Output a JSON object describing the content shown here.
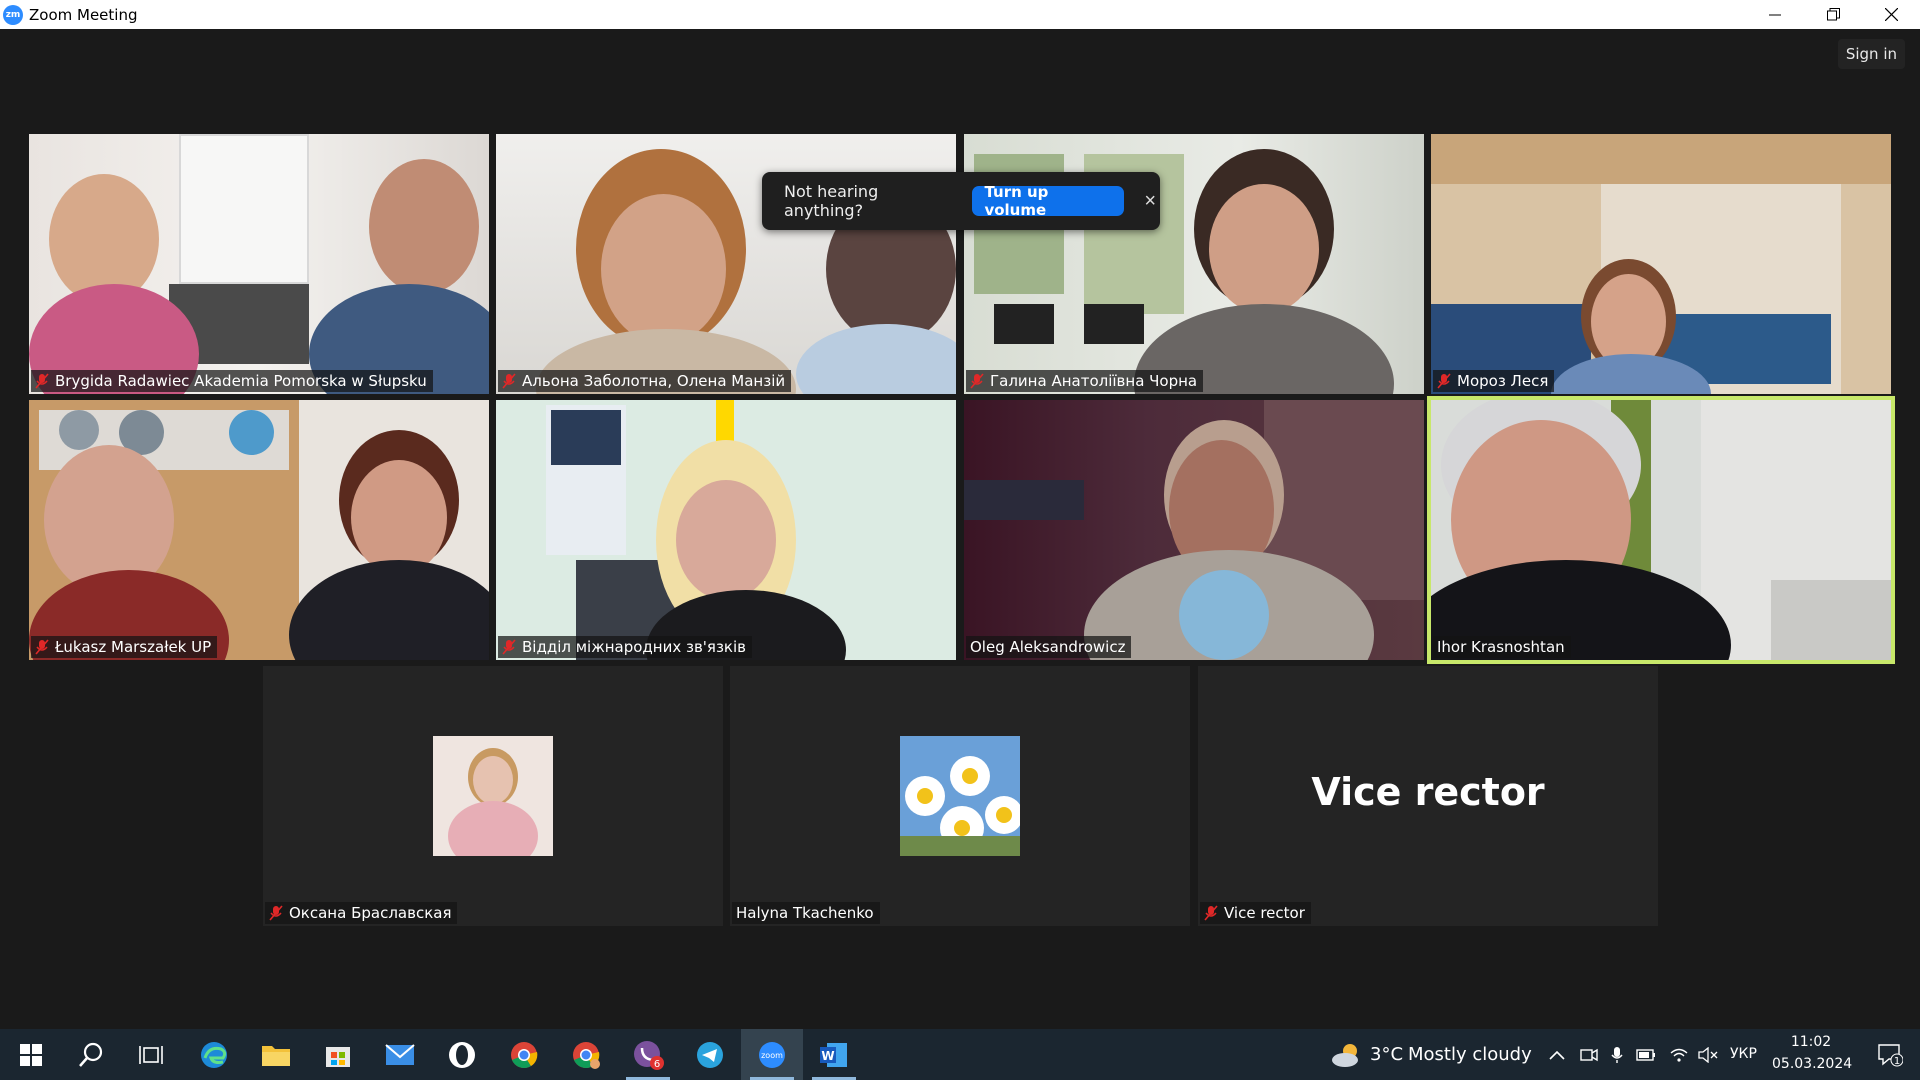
{
  "window": {
    "title": "Zoom Meeting"
  },
  "header": {
    "sign_in_label": "Sign in"
  },
  "popup": {
    "message": "Not hearing anything?",
    "button_label": "Turn up volume",
    "close_label": "×"
  },
  "participants": [
    {
      "name": "Brygida Radawiec Akademia Pomorska w Słupsku",
      "muted": true
    },
    {
      "name": "Альона Заболотна, Олена Манзій",
      "muted": true
    },
    {
      "name": "Галина Анатоліївна Чорна",
      "muted": true
    },
    {
      "name": "Мороз Леся",
      "muted": true
    },
    {
      "name": "Łukasz Marszałek UP",
      "muted": true
    },
    {
      "name": "Відділ міжнародних зв'язків",
      "muted": true
    },
    {
      "name": "Oleg Aleksandrowicz",
      "muted": false
    },
    {
      "name": "Ihor Krasnoshtan",
      "muted": false,
      "active_speaker": true
    },
    {
      "name": "Оксана Браславская",
      "muted": true
    },
    {
      "name": "Halyna Tkachenko",
      "muted": false
    },
    {
      "name": "Vice rector",
      "muted": true,
      "display_text": "Vice rector"
    }
  ],
  "taskbar": {
    "apps": [
      "windows-start",
      "search",
      "task-view",
      "edge",
      "file-explorer",
      "microsoft-store",
      "mail",
      "opera",
      "chrome",
      "chrome-profile",
      "viber",
      "telegram",
      "zoom",
      "word"
    ],
    "viber_badge": "6",
    "weather": {
      "temp": "3°C",
      "condition": "Mostly cloudy"
    },
    "language": "УКР",
    "time": "11:02",
    "date": "05.03.2024",
    "notification_count": "1"
  },
  "colors": {
    "active_speaker_border": "#c8e86a",
    "popup_button": "#0e71eb",
    "mute_icon": "#e02828"
  }
}
